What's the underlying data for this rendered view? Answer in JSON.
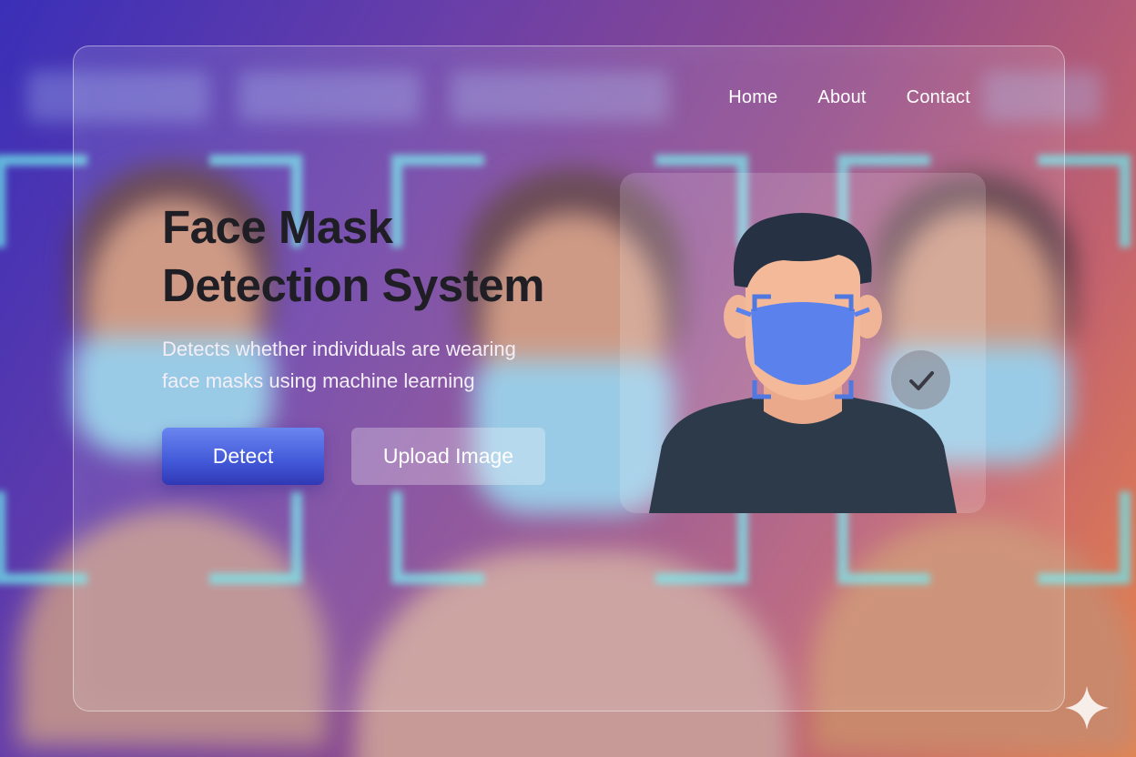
{
  "nav": {
    "items": [
      {
        "label": "Home"
      },
      {
        "label": "About"
      },
      {
        "label": "Contact"
      }
    ]
  },
  "hero": {
    "title_line1": "Face Mask",
    "title_line2": "Detection System",
    "subtitle_line1": "Detects whether individuals are wearing",
    "subtitle_line2": "face masks using machine learning"
  },
  "actions": {
    "detect_label": "Detect",
    "upload_label": "Upload Image"
  },
  "illustration": {
    "status_icon": "checkmark-icon",
    "colors": {
      "mask": "#5b82ec",
      "hair": "#263244",
      "shirt": "#2d3a4a",
      "skin": "#f4b998",
      "bracket": "#4f78e0"
    }
  },
  "theme": {
    "button_primary": "#4a5ee0",
    "frame_accent": "#6ee6eb"
  }
}
